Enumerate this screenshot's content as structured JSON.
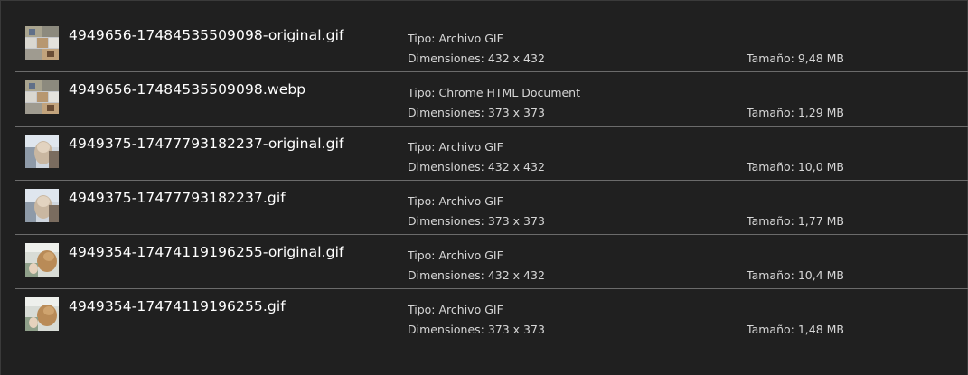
{
  "files": [
    {
      "name": "4949656-17484535509098-original.gif",
      "type": "Tipo: Archivo GIF",
      "dimensions": "Dimensiones: 432 x 432",
      "size": "Tamaño: 9,48 MB",
      "thumbnail": "collage-thumbnail"
    },
    {
      "name": "4949656-17484535509098.webp",
      "type": "Tipo: Chrome HTML Document",
      "dimensions": "Dimensiones: 373 x 373",
      "size": "Tamaño: 1,29 MB",
      "thumbnail": "collage-thumbnail"
    },
    {
      "name": "4949375-17477793182237-original.gif",
      "type": "Tipo: Archivo GIF",
      "dimensions": "Dimensiones: 432 x 432",
      "size": "Tamaño: 10,0 MB",
      "thumbnail": "portrait-thumbnail"
    },
    {
      "name": "4949375-17477793182237.gif",
      "type": "Tipo: Archivo GIF",
      "dimensions": "Dimensiones: 373 x 373",
      "size": "Tamaño: 1,77 MB",
      "thumbnail": "portrait-thumbnail"
    },
    {
      "name": "4949354-17474119196255-original.gif",
      "type": "Tipo: Archivo GIF",
      "dimensions": "Dimensiones: 432 x 432",
      "size": "Tamaño: 10,4 MB",
      "thumbnail": "dog-thumbnail"
    },
    {
      "name": "4949354-17474119196255.gif",
      "type": "Tipo: Archivo GIF",
      "dimensions": "Dimensiones: 373 x 373",
      "size": "Tamaño: 1,48 MB",
      "thumbnail": "dog-thumbnail"
    }
  ],
  "colors": {
    "background": "#202020",
    "divider": "#6b6b6b",
    "filename_text": "#ffffff",
    "detail_text": "#d6d6d6"
  }
}
